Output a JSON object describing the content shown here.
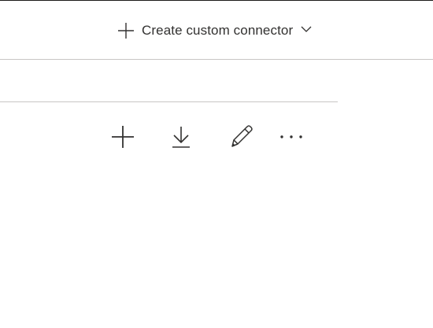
{
  "command_bar": {
    "create_label": "Create custom connector",
    "create_icon": "plus-icon",
    "dropdown_icon": "chevron-down-icon"
  },
  "row_actions": {
    "items": [
      {
        "name": "add",
        "icon": "plus-icon"
      },
      {
        "name": "download",
        "icon": "download-icon"
      },
      {
        "name": "edit",
        "icon": "pencil-icon"
      },
      {
        "name": "more",
        "icon": "more-icon"
      }
    ]
  },
  "colors": {
    "text": "#323130",
    "icon": "#323130",
    "divider": "#c8c6c4",
    "background": "#ffffff"
  }
}
